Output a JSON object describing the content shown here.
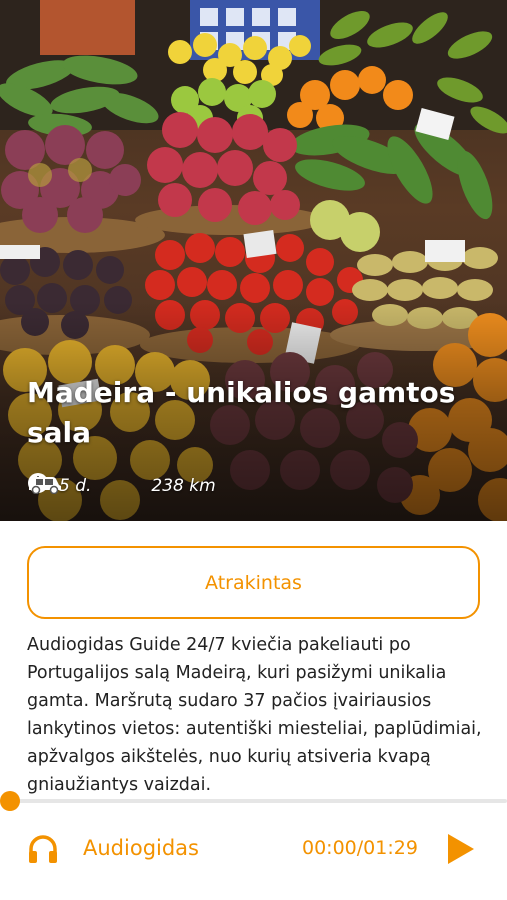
{
  "hero": {
    "title": "Madeira - unikalios gamtos sala",
    "duration": "5 d.",
    "distance": "238 km",
    "icons": {
      "duration": "clock-icon",
      "distance": "car-icon"
    }
  },
  "unlock_button": {
    "label": "Atrakintas"
  },
  "description": "Audiogidas Guide 24/7 kviečia pakeliauti po Portugalijos salą Madeirą, kuri pasižymi unikalia gamta. Maršrutą sudaro 37 pačios įvairiausios lankytinos vietos: autentiški miesteliai, paplūdimiai, apžvalgos aikštelės, nuo kurių atsiveria kvapą gniaužiantys vaizdai.",
  "player": {
    "label": "Audiogidas",
    "time": "00:00/01:29",
    "progress": 0,
    "icons": {
      "audio": "headphones-icon",
      "play": "play-icon"
    }
  },
  "colors": {
    "accent": "#f39200",
    "text": "#222222",
    "hero_text": "#ffffff"
  }
}
